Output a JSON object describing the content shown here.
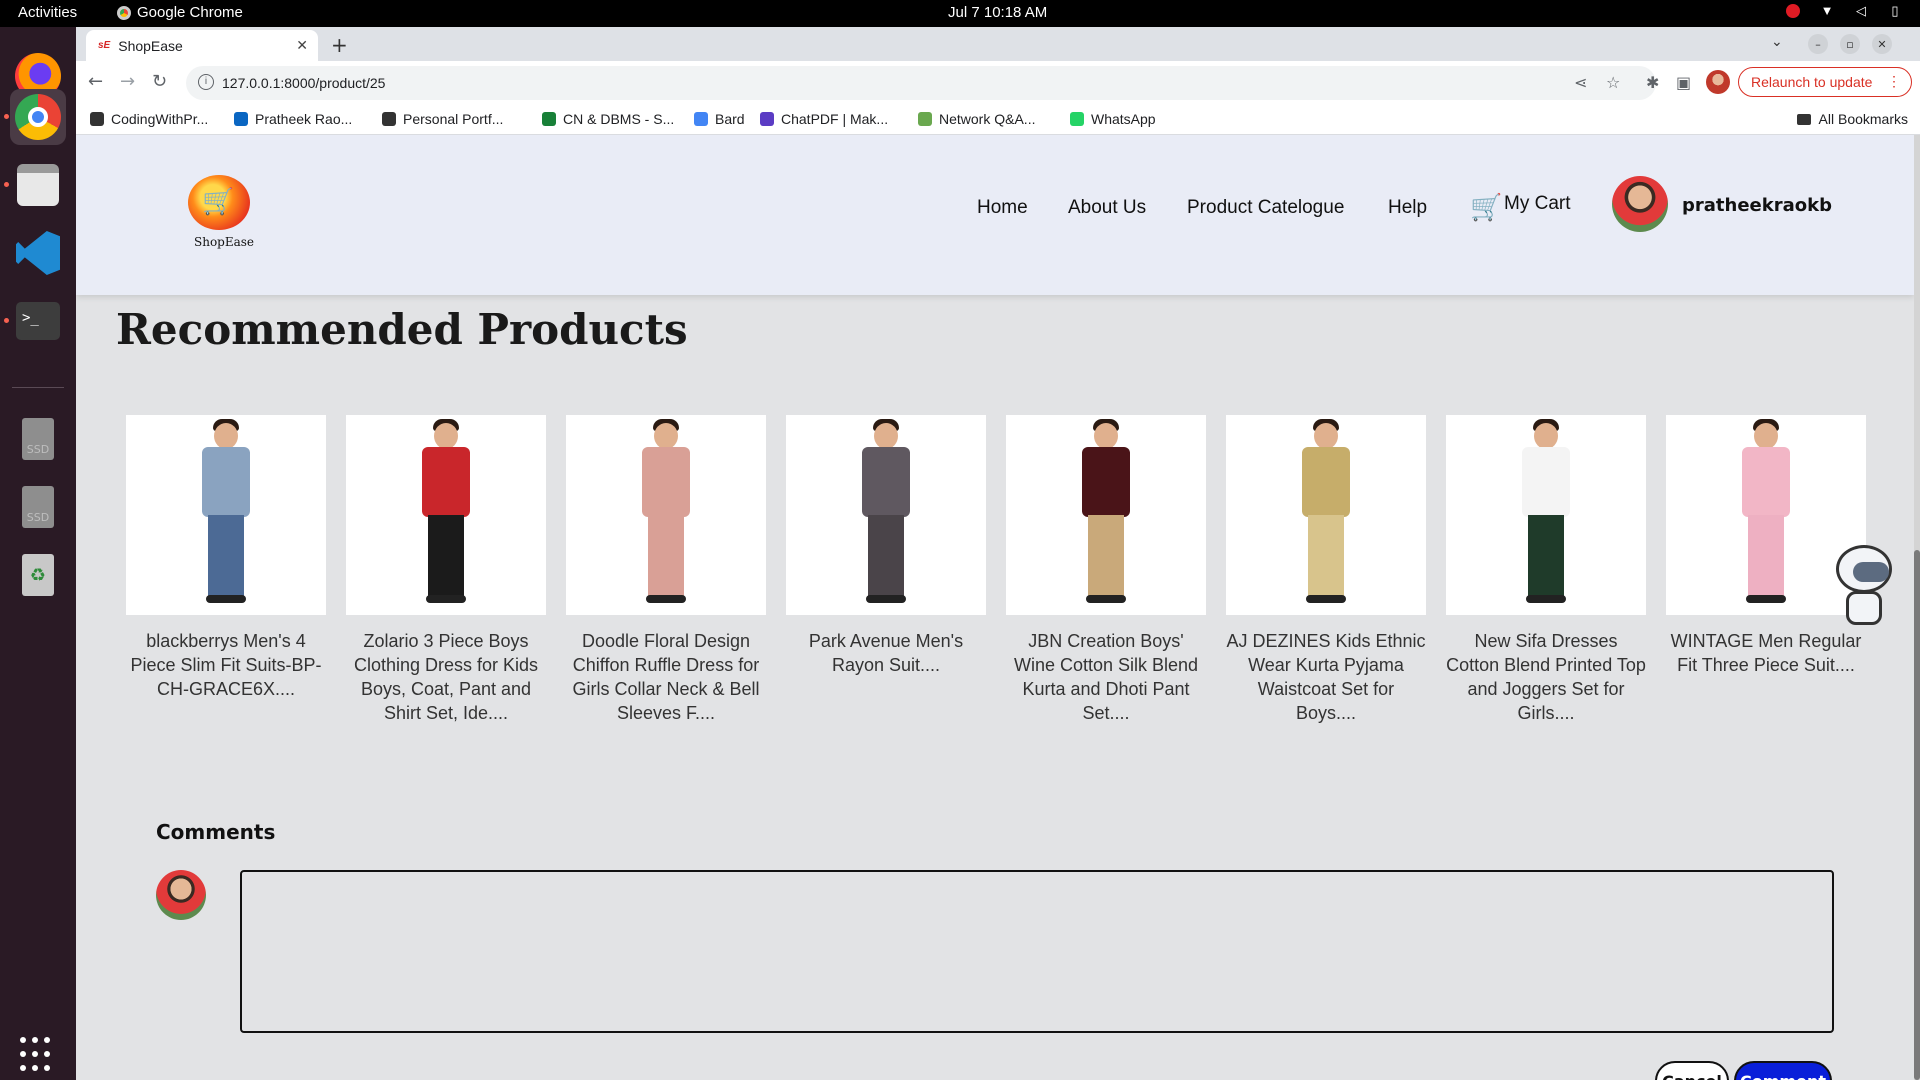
{
  "os": {
    "activities": "Activities",
    "app_name": "Google Chrome",
    "clock": "Jul 7  10:18 AM"
  },
  "dock": {
    "apps": [
      "firefox-icon",
      "chrome-icon",
      "files-icon",
      "vscode-icon",
      "terminal-icon",
      "ssd-drive-icon",
      "ssd-drive-icon",
      "trash-icon",
      "app-grid-icon"
    ],
    "ssd_label": "SSD"
  },
  "browser": {
    "tab_title": "ShopEase",
    "tab_favicon": "sE",
    "url": "127.0.0.1:8000/product/25",
    "relaunch_label": "Relaunch to update",
    "bookmarks": [
      {
        "label": "CodingWithPr...",
        "color": "#333333"
      },
      {
        "label": "Pratheek Rao...",
        "color": "#0a66c2"
      },
      {
        "label": "Personal Portf...",
        "color": "#333333"
      },
      {
        "label": "CN & DBMS - S...",
        "color": "#188038"
      },
      {
        "label": "Bard",
        "color": "#4285f4"
      },
      {
        "label": "ChatPDF | Mak...",
        "color": "#5b3cc4"
      },
      {
        "label": "Network Q&A...",
        "color": "#6aa84f"
      },
      {
        "label": "WhatsApp",
        "color": "#25d366"
      }
    ],
    "all_bookmarks": "All Bookmarks"
  },
  "site": {
    "logo_text": "ShopEase",
    "nav": {
      "home": "Home",
      "about": "About Us",
      "catalogue": "Product Catelogue",
      "help": "Help",
      "cart": "My Cart"
    },
    "username": "pratheekraokb",
    "accent_color": "#0a1fd9"
  },
  "recommended": {
    "title": "Recommended Products",
    "products": [
      {
        "name": "blackberrys Men's 4 Piece Slim Fit Suits-BP-CH-GRACE6X....",
        "top": "#8aa3c0",
        "bottom": "#4c6a95"
      },
      {
        "name": "Zolario 3 Piece Boys Clothing Dress for Kids Boys, Coat, Pant and Shirt Set, Ide....",
        "top": "#c9262b",
        "bottom": "#1b1b1b"
      },
      {
        "name": "Doodle Floral Design Chiffon Ruffle Dress for Girls Collar Neck & Bell Sleeves F....",
        "top": "#d9a096",
        "bottom": "#d9a096"
      },
      {
        "name": "Park Avenue Men's Rayon Suit....",
        "top": "#5f5860",
        "bottom": "#4a4449"
      },
      {
        "name": "JBN Creation Boys' Wine Cotton Silk Blend Kurta and Dhoti Pant Set....",
        "top": "#4a1418",
        "bottom": "#c9a97a"
      },
      {
        "name": "AJ DEZINES Kids Ethnic Wear Kurta Pyjama Waistcoat Set for Boys....",
        "top": "#c6ad6a",
        "bottom": "#d8c48c"
      },
      {
        "name": "New Sifa Dresses Cotton Blend Printed Top and Joggers Set for Girls....",
        "top": "#f4f4f4",
        "bottom": "#1f3b2a"
      },
      {
        "name": "WINTAGE Men Regular Fit Three Piece Suit....",
        "top": "#f2b6c6",
        "bottom": "#eeb0c2"
      }
    ]
  },
  "comments": {
    "title": "Comments",
    "input_value": "",
    "cancel_label": "Cancel",
    "submit_label": "Comment"
  }
}
